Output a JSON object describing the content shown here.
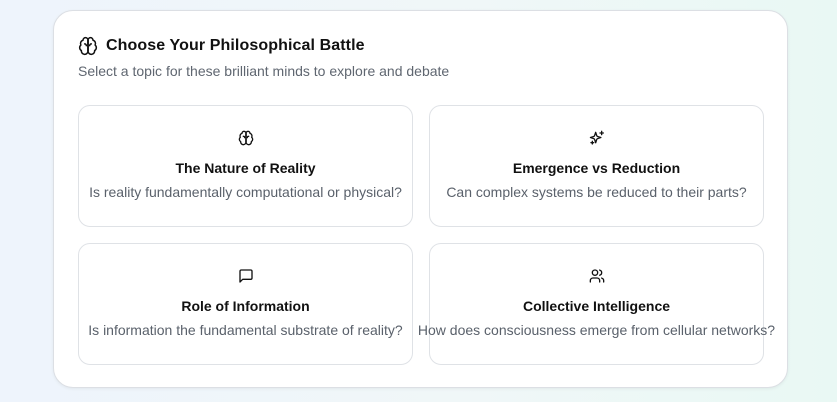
{
  "header": {
    "icon": "brain-icon",
    "title": "Choose Your Philosophical Battle",
    "subtitle": "Select a topic for these brilliant minds to explore and debate"
  },
  "topics": [
    {
      "icon": "brain-icon",
      "title": "The Nature of Reality",
      "description": "Is reality fundamentally computational or physical?"
    },
    {
      "icon": "sparkles-icon",
      "title": "Emergence vs Reduction",
      "description": "Can complex systems be reduced to their parts?"
    },
    {
      "icon": "message-square-icon",
      "title": "Role of Information",
      "description": "Is information the fundamental substrate of reality?"
    },
    {
      "icon": "users-icon",
      "title": "Collective Intelligence",
      "description": "How does consciousness emerge from cellular networks?"
    }
  ]
}
